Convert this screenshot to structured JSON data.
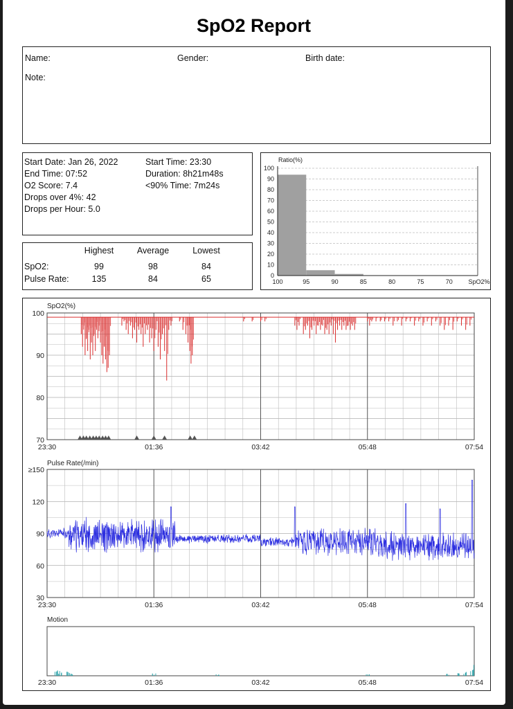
{
  "report": {
    "title": "SpO2 Report",
    "patient": {
      "name_label": "Name:",
      "gender_label": "Gender:",
      "birth_label": "Birth date:",
      "note_label": "Note:"
    },
    "summary": {
      "start_date": "Start Date: Jan 26, 2022",
      "end_time": "End Time: 07:52",
      "o2_score": "O2 Score: 7.4",
      "drops_over": "Drops over 4%: 42",
      "drops_per_hour": "Drops per Hour: 5.0",
      "start_time": "Start Time: 23:30",
      "duration": "Duration: 8h21m48s",
      "below90": "<90% Time: 7m24s"
    },
    "stats": {
      "headers": [
        "Highest",
        "Average",
        "Lowest"
      ],
      "rows": [
        {
          "label": "SpO2:",
          "values": [
            "99",
            "98",
            "84"
          ]
        },
        {
          "label": "Pulse Rate:",
          "values": [
            "135",
            "84",
            "65"
          ]
        }
      ]
    }
  },
  "chart_data": [
    {
      "type": "bar",
      "title": "Ratio(%)",
      "xlabel": "SpO2%",
      "x_ticks": [
        "100",
        "95",
        "90",
        "85",
        "80",
        "75",
        "70"
      ],
      "y_ticks": [
        "0",
        "10",
        "20",
        "30",
        "40",
        "50",
        "60",
        "70",
        "80",
        "90",
        "100"
      ],
      "ylim": [
        0,
        100
      ],
      "bins": [
        {
          "from": 100,
          "to": 95,
          "value": 94
        },
        {
          "from": 95,
          "to": 90,
          "value": 5
        },
        {
          "from": 90,
          "to": 85,
          "value": 1.5
        }
      ],
      "color": "#a0a0a0",
      "grid": true
    },
    {
      "type": "line",
      "title": "SpO2(%)",
      "ylim": [
        70,
        100
      ],
      "y_ticks": [
        "70",
        "80",
        "90",
        "100"
      ],
      "x_ticks": [
        "23:30",
        "01:36",
        "03:42",
        "05:48",
        "07:54"
      ],
      "baseline": 99,
      "color": "#d92b2b",
      "note": "vertical drops",
      "drops": [
        {
          "x": 0.08,
          "y": 95
        },
        {
          "x": 0.083,
          "y": 92
        },
        {
          "x": 0.086,
          "y": 97
        },
        {
          "x": 0.089,
          "y": 90
        },
        {
          "x": 0.092,
          "y": 94
        },
        {
          "x": 0.095,
          "y": 91
        },
        {
          "x": 0.098,
          "y": 96
        },
        {
          "x": 0.101,
          "y": 89
        },
        {
          "x": 0.104,
          "y": 93
        },
        {
          "x": 0.107,
          "y": 90
        },
        {
          "x": 0.11,
          "y": 95
        },
        {
          "x": 0.113,
          "y": 91
        },
        {
          "x": 0.116,
          "y": 96
        },
        {
          "x": 0.119,
          "y": 94
        },
        {
          "x": 0.122,
          "y": 97
        },
        {
          "x": 0.125,
          "y": 93
        },
        {
          "x": 0.128,
          "y": 90
        },
        {
          "x": 0.131,
          "y": 88
        },
        {
          "x": 0.134,
          "y": 92
        },
        {
          "x": 0.137,
          "y": 89
        },
        {
          "x": 0.14,
          "y": 86
        },
        {
          "x": 0.143,
          "y": 87
        },
        {
          "x": 0.146,
          "y": 90
        },
        {
          "x": 0.175,
          "y": 97
        },
        {
          "x": 0.18,
          "y": 98
        },
        {
          "x": 0.185,
          "y": 96
        },
        {
          "x": 0.19,
          "y": 95
        },
        {
          "x": 0.195,
          "y": 97
        },
        {
          "x": 0.2,
          "y": 94
        },
        {
          "x": 0.205,
          "y": 96
        },
        {
          "x": 0.21,
          "y": 93
        },
        {
          "x": 0.215,
          "y": 96
        },
        {
          "x": 0.22,
          "y": 95
        },
        {
          "x": 0.225,
          "y": 92
        },
        {
          "x": 0.23,
          "y": 95
        },
        {
          "x": 0.235,
          "y": 96
        },
        {
          "x": 0.24,
          "y": 93
        },
        {
          "x": 0.245,
          "y": 94
        },
        {
          "x": 0.25,
          "y": 91
        },
        {
          "x": 0.255,
          "y": 96
        },
        {
          "x": 0.26,
          "y": 92
        },
        {
          "x": 0.265,
          "y": 89
        },
        {
          "x": 0.27,
          "y": 95
        },
        {
          "x": 0.275,
          "y": 91
        },
        {
          "x": 0.28,
          "y": 84
        },
        {
          "x": 0.285,
          "y": 96
        },
        {
          "x": 0.29,
          "y": 97
        },
        {
          "x": 0.31,
          "y": 98
        },
        {
          "x": 0.318,
          "y": 96
        },
        {
          "x": 0.325,
          "y": 95
        },
        {
          "x": 0.33,
          "y": 93
        },
        {
          "x": 0.334,
          "y": 91
        },
        {
          "x": 0.337,
          "y": 88
        },
        {
          "x": 0.34,
          "y": 90
        },
        {
          "x": 0.46,
          "y": 98
        },
        {
          "x": 0.48,
          "y": 98
        },
        {
          "x": 0.5,
          "y": 98
        },
        {
          "x": 0.51,
          "y": 98
        },
        {
          "x": 0.58,
          "y": 97
        },
        {
          "x": 0.585,
          "y": 96
        },
        {
          "x": 0.59,
          "y": 97
        },
        {
          "x": 0.6,
          "y": 95
        },
        {
          "x": 0.605,
          "y": 96
        },
        {
          "x": 0.61,
          "y": 97
        },
        {
          "x": 0.615,
          "y": 94
        },
        {
          "x": 0.62,
          "y": 96
        },
        {
          "x": 0.625,
          "y": 97
        },
        {
          "x": 0.63,
          "y": 95
        },
        {
          "x": 0.635,
          "y": 97
        },
        {
          "x": 0.64,
          "y": 96
        },
        {
          "x": 0.645,
          "y": 97
        },
        {
          "x": 0.65,
          "y": 95
        },
        {
          "x": 0.655,
          "y": 96
        },
        {
          "x": 0.66,
          "y": 95
        },
        {
          "x": 0.665,
          "y": 97
        },
        {
          "x": 0.67,
          "y": 95
        },
        {
          "x": 0.675,
          "y": 93
        },
        {
          "x": 0.68,
          "y": 96
        },
        {
          "x": 0.685,
          "y": 97
        },
        {
          "x": 0.69,
          "y": 96
        },
        {
          "x": 0.695,
          "y": 97
        },
        {
          "x": 0.7,
          "y": 96
        },
        {
          "x": 0.705,
          "y": 97
        },
        {
          "x": 0.71,
          "y": 96
        },
        {
          "x": 0.715,
          "y": 97
        },
        {
          "x": 0.72,
          "y": 96
        },
        {
          "x": 0.75,
          "y": 98
        },
        {
          "x": 0.755,
          "y": 97
        },
        {
          "x": 0.76,
          "y": 98
        },
        {
          "x": 0.77,
          "y": 98
        },
        {
          "x": 0.78,
          "y": 98
        },
        {
          "x": 0.79,
          "y": 98
        },
        {
          "x": 0.8,
          "y": 98
        },
        {
          "x": 0.81,
          "y": 97
        },
        {
          "x": 0.82,
          "y": 98
        },
        {
          "x": 0.83,
          "y": 97
        },
        {
          "x": 0.84,
          "y": 98
        },
        {
          "x": 0.85,
          "y": 98
        },
        {
          "x": 0.86,
          "y": 97
        },
        {
          "x": 0.87,
          "y": 98
        },
        {
          "x": 0.88,
          "y": 97
        },
        {
          "x": 0.89,
          "y": 98
        },
        {
          "x": 0.9,
          "y": 97
        },
        {
          "x": 0.91,
          "y": 98
        },
        {
          "x": 0.92,
          "y": 97
        },
        {
          "x": 0.93,
          "y": 96
        },
        {
          "x": 0.94,
          "y": 97
        },
        {
          "x": 0.95,
          "y": 96
        },
        {
          "x": 0.96,
          "y": 98
        },
        {
          "x": 0.97,
          "y": 97
        },
        {
          "x": 0.98,
          "y": 96
        },
        {
          "x": 0.99,
          "y": 97
        }
      ],
      "drop_markers_x": [
        0.077,
        0.085,
        0.092,
        0.1,
        0.108,
        0.115,
        0.122,
        0.13,
        0.137,
        0.144,
        0.21,
        0.25,
        0.275,
        0.335,
        0.345
      ]
    },
    {
      "type": "line",
      "title": "Pulse Rate(/min)",
      "ylim": [
        30,
        150
      ],
      "y_ticks": [
        "30",
        "60",
        "90",
        "120",
        "≥150"
      ],
      "x_ticks": [
        "23:30",
        "01:36",
        "03:42",
        "05:48",
        "07:54"
      ],
      "color": "#2c2ee0",
      "segments": [
        {
          "from": 0.0,
          "to": 0.05,
          "base": 90,
          "amp": 6
        },
        {
          "from": 0.05,
          "to": 0.3,
          "base": 88,
          "amp": 18
        },
        {
          "from": 0.3,
          "to": 0.5,
          "base": 85,
          "amp": 5
        },
        {
          "from": 0.5,
          "to": 0.58,
          "base": 82,
          "amp": 5
        },
        {
          "from": 0.58,
          "to": 0.78,
          "base": 82,
          "amp": 15
        },
        {
          "from": 0.78,
          "to": 1.0,
          "base": 78,
          "amp": 15
        }
      ],
      "spikes": [
        {
          "x": 0.29,
          "y": 115
        },
        {
          "x": 0.58,
          "y": 115
        },
        {
          "x": 0.84,
          "y": 118
        },
        {
          "x": 0.92,
          "y": 113
        },
        {
          "x": 0.995,
          "y": 140
        }
      ]
    },
    {
      "type": "area",
      "title": "Motion",
      "x_ticks": [
        "23:30",
        "01:36",
        "03:42",
        "05:48",
        "07:54"
      ],
      "color": "#2aa1a8",
      "bursts": [
        {
          "x": 0.02,
          "h": 0.18
        },
        {
          "x": 0.025,
          "h": 0.12
        },
        {
          "x": 0.03,
          "h": 0.08
        },
        {
          "x": 0.05,
          "h": 0.1
        },
        {
          "x": 0.06,
          "h": 0.06
        },
        {
          "x": 0.25,
          "h": 0.05
        },
        {
          "x": 0.4,
          "h": 0.03
        },
        {
          "x": 0.75,
          "h": 0.03
        },
        {
          "x": 0.94,
          "h": 0.06
        },
        {
          "x": 0.96,
          "h": 0.07
        },
        {
          "x": 0.98,
          "h": 0.08
        },
        {
          "x": 0.995,
          "h": 0.25
        }
      ]
    }
  ]
}
